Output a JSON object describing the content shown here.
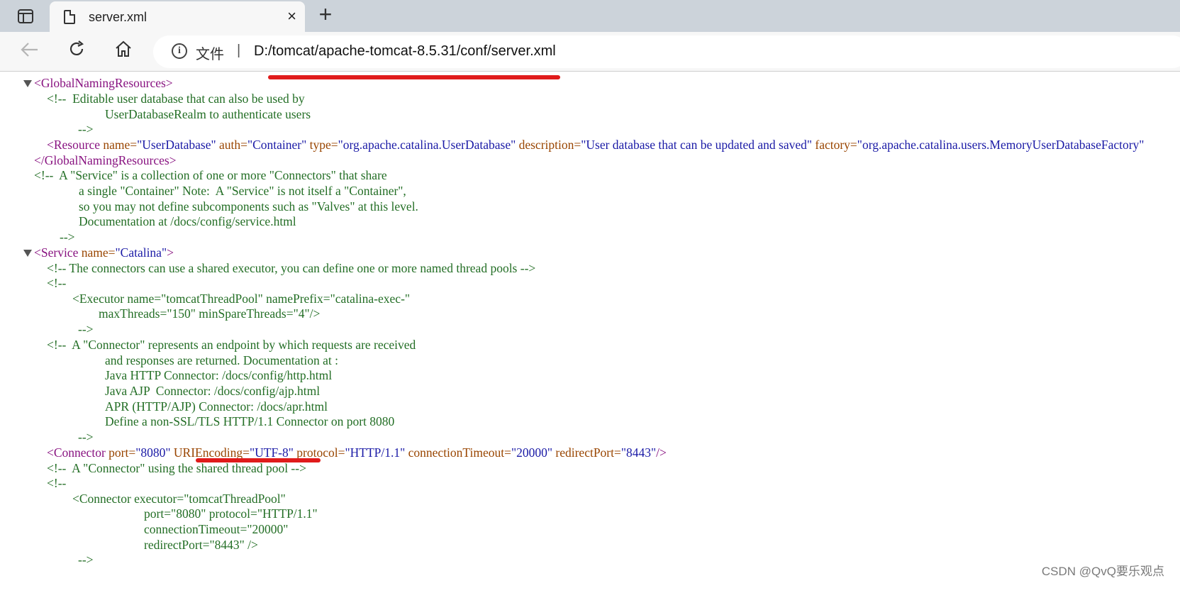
{
  "browser": {
    "tab_title": "server.xml",
    "close_symbol": "×",
    "new_tab_symbol": "+",
    "scheme_label": "文件",
    "separator": "|",
    "url": "D:/tomcat/apache-tomcat-8.5.31/conf/server.xml"
  },
  "xml_lines": {
    "l1": "<GlobalNamingResources>",
    "l2": "<!--  Editable user database that can also be used by",
    "l3": "UserDatabaseRealm to authenticate users",
    "l4": "-->",
    "l5_tag_open": "<Resource",
    "l5_attr_name": " name=",
    "l5_val_name": "\"UserDatabase\"",
    "l5_attr_auth": " auth=",
    "l5_val_auth": "\"Container\"",
    "l5_attr_type": " type=",
    "l5_val_type": "\"org.apache.catalina.UserDatabase\"",
    "l5_attr_desc": " description=",
    "l5_val_desc": "\"User database that can be updated and saved\"",
    "l5_attr_factory": " factory=",
    "l5_val_factory": "\"org.apache.catalina.users.MemoryUserDatabaseFactory\"",
    "l6": "</GlobalNamingResources>",
    "l7": "<!--  A \"Service\" is a collection of one or more \"Connectors\" that share",
    "l8": "a single \"Container\" Note:  A \"Service\" is not itself a \"Container\",",
    "l9": "so you may not define subcomponents such as \"Valves\" at this level.",
    "l10": "Documentation at /docs/config/service.html",
    "l11": "-->",
    "l12_tag": "<Service",
    "l12_attr": " name=",
    "l12_val": "\"Catalina\"",
    "l12_close": ">",
    "l13": "<!-- The connectors can use a shared executor, you can define one or more named thread pools -->",
    "l14": "<!--",
    "l15": "<Executor name=\"tomcatThreadPool\" namePrefix=\"catalina-exec-\"",
    "l16": "maxThreads=\"150\" minSpareThreads=\"4\"/>",
    "l17": "-->",
    "l18": "<!--  A \"Connector\" represents an endpoint by which requests are received",
    "l19": "and responses are returned. Documentation at :",
    "l20": "Java HTTP Connector: /docs/config/http.html",
    "l21": "Java AJP  Connector: /docs/config/ajp.html",
    "l22": "APR (HTTP/AJP) Connector: /docs/apr.html",
    "l23": "Define a non-SSL/TLS HTTP/1.1 Connector on port 8080",
    "l24": "-->",
    "l25_tag": "<Connector",
    "l25_attr_port": " port=",
    "l25_val_port": "\"8080\"",
    "l25_attr_uri": "URIEncoding=",
    "l25_val_uri": "\"UTF-8\"",
    "l25_attr_protocol": " protocol=",
    "l25_val_protocol": "\"HTTP/1.1\"",
    "l25_attr_timeout": " connectionTimeout=",
    "l25_val_timeout": "\"20000\"",
    "l25_attr_redirect": " redirectPort=",
    "l25_val_redirect": "\"8443\"",
    "l25_close": "/>",
    "l26": "<!--  A \"Connector\" using the shared thread pool -->",
    "l27": "<!--",
    "l28": "<Connector executor=\"tomcatThreadPool\"",
    "l29": "port=\"8080\" protocol=\"HTTP/1.1\"",
    "l30": "connectionTimeout=\"20000\"",
    "l31": "redirectPort=\"8443\" />",
    "l32": "-->"
  },
  "watermark": "CSDN @QvQ要乐观点",
  "colors": {
    "tag": "#881280",
    "attribute": "#994500",
    "value": "#1a1aa6",
    "comment": "#236e25",
    "annotation_underline": "#e01b1b"
  }
}
